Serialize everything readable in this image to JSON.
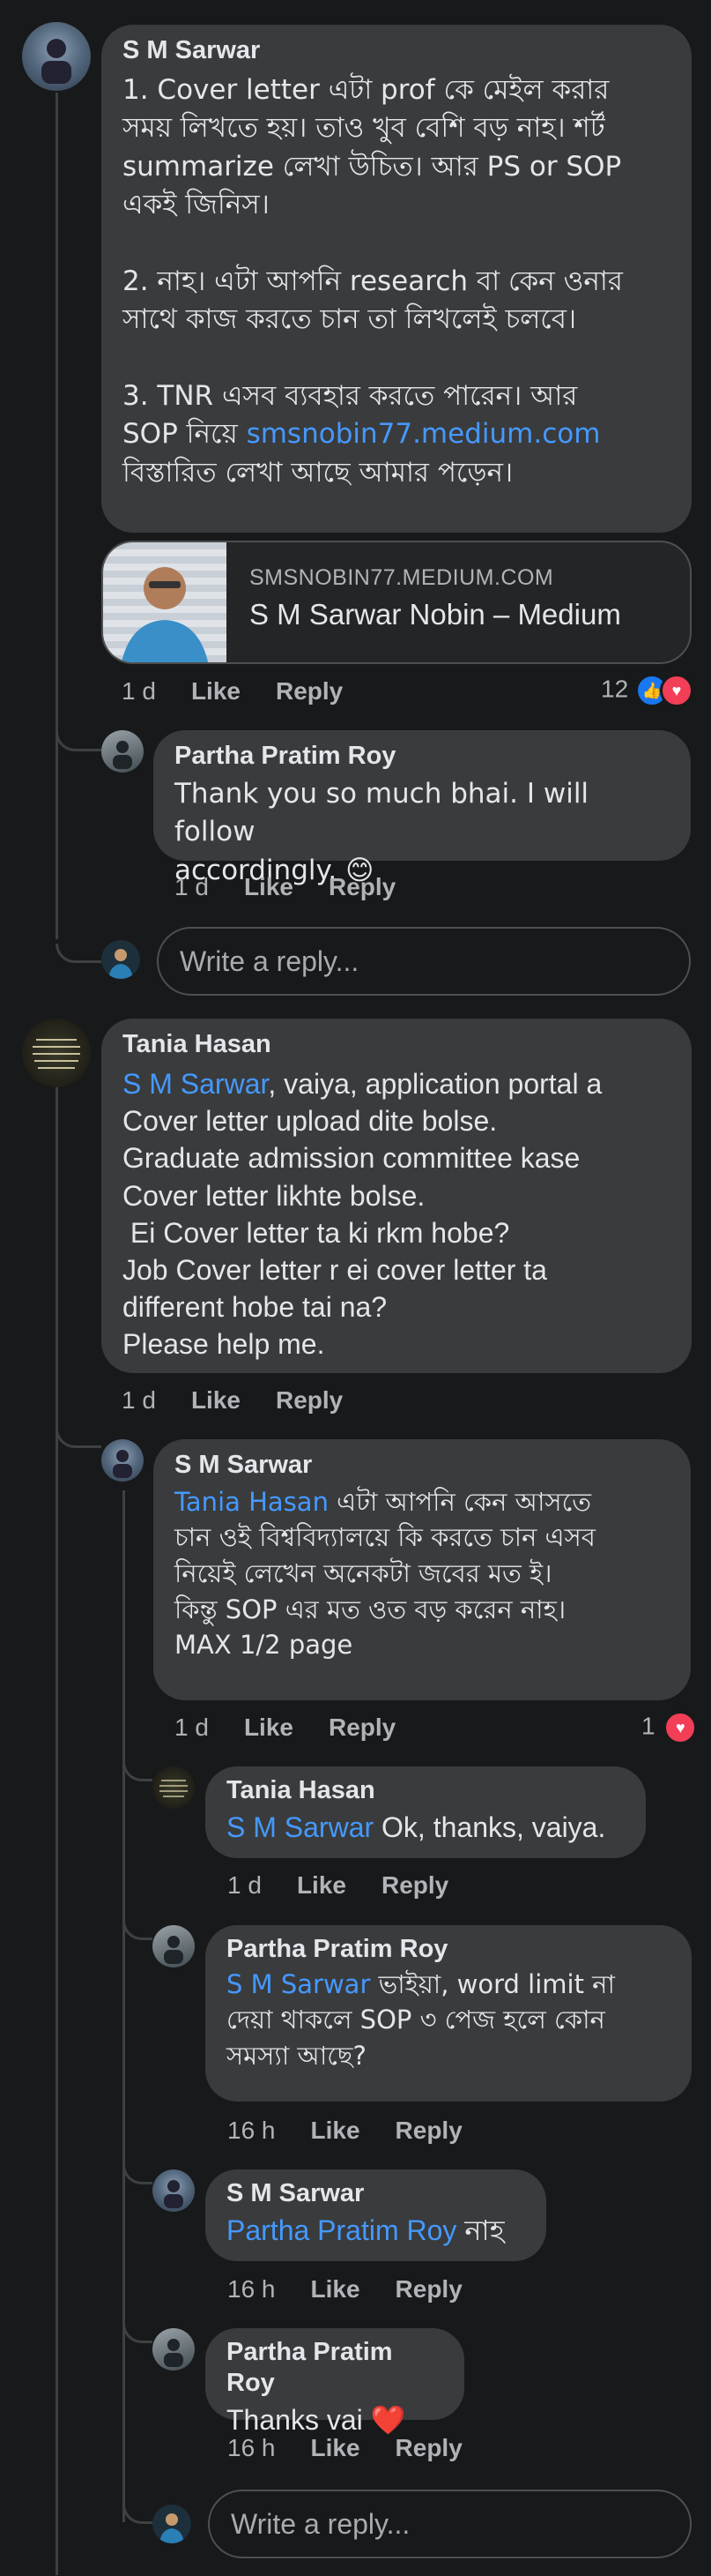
{
  "colors": {
    "background": "#18191a",
    "bubble": "#3a3b3c",
    "mention": "#4599ff",
    "muted": "#b0b3b8",
    "like": "#1877f2",
    "love": "#f33e58"
  },
  "thread": {
    "comment1": {
      "author": "S M Sarwar",
      "text1": "1. Cover letter এটা prof কে মেইল করার\nসময় লিখতে হয়। তাও খুব বেশি বড় নাহ। শর্ট\nsummarize লেখা উচিত। আর PS or SOP\nএকই জিনিস।\n\n2. নাহ। এটা আপনি research বা কেন ওনার\nসাথে কাজ করতে চান তা লিখলেই চলবে।\n\n3. TNR এসব ব্যবহার করতে পারেন। আর\nSOP নিয়ে ",
      "link": "smsnobin77.medium.com",
      "text2": "\nবিস্তারিত লেখা আছে আমার পড়েন।",
      "card_domain": "SMSNOBIN77.MEDIUM.COM",
      "card_title": "S M Sarwar Nobin – Medium",
      "time": "1 d",
      "like": "Like",
      "reply": "Reply",
      "reaction_count": "12",
      "reply1": {
        "author": "Partha Pratim Roy",
        "text": "Thank you so much bhai. I will follow\naccordingly. 😊",
        "time": "1 d",
        "like": "Like",
        "reply": "Reply"
      },
      "reply_placeholder": "Write a reply..."
    },
    "comment2": {
      "author": "Tania Hasan",
      "mention": "S M Sarwar",
      "text": ", vaiya, application portal a\nCover letter upload dite bolse.\nGraduate admission committee kase\nCover letter likhte bolse.\n Ei Cover letter ta ki rkm hobe?\nJob Cover letter r ei cover letter ta\ndifferent hobe tai na?\nPlease help me.",
      "time": "1 d",
      "like": "Like",
      "reply": "Reply",
      "r1": {
        "author": "S M Sarwar",
        "mention": "Tania Hasan",
        "text": " এটা আপনি কেন আসতে\nচান ওই বিশ্ববিদ্যালয়ে কি করতে চান এসব\nনিয়েই লেখেন অনেকটা জবের মত ই।\nকিন্তু SOP এর মত ওত বড় করেন নাহ।\nMAX 1/2 page",
        "time": "1 d",
        "like": "Like",
        "reply": "Reply",
        "reaction_count": "1"
      },
      "r2": {
        "author": "Tania Hasan",
        "mention": "S M Sarwar",
        "text": " Ok, thanks, vaiya.",
        "time": "1 d",
        "like": "Like",
        "reply": "Reply"
      },
      "r3": {
        "author": "Partha Pratim Roy",
        "mention": "S M Sarwar",
        "text": " ভাইয়া, word limit না\nদেয়া থাকলে SOP ৩ পেজ হলে কোন\nসমস্যা আছে?",
        "time": "16 h",
        "like": "Like",
        "reply": "Reply"
      },
      "r4": {
        "author": "S M Sarwar",
        "mention": "Partha Pratim Roy",
        "text": " নাহ",
        "time": "16 h",
        "like": "Like",
        "reply": "Reply"
      },
      "r5": {
        "author": "Partha Pratim Roy",
        "text": "Thanks vai ❤️",
        "time": "16 h",
        "like": "Like",
        "reply": "Reply"
      },
      "reply_placeholder": "Write a reply..."
    }
  }
}
